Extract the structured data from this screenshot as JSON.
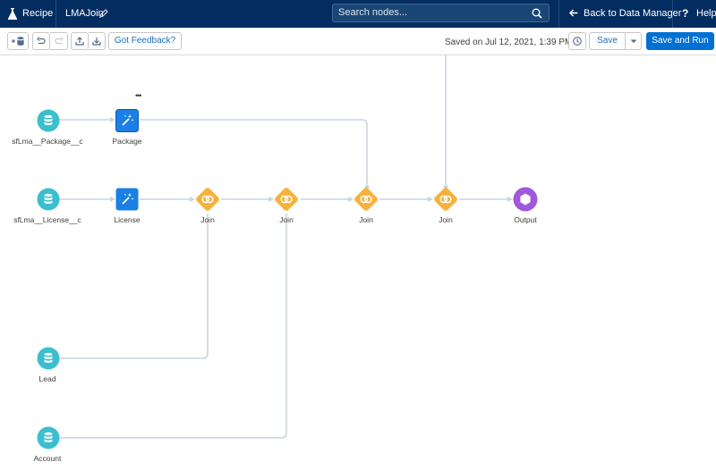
{
  "topbar": {
    "app_label": "Recipe",
    "recipe_name": "LMAJoin",
    "search_placeholder": "Search nodes...",
    "back_label": "Back to Data Manager",
    "help_label": "Help"
  },
  "toolbar": {
    "feedback_label": "Got Feedback?",
    "saved_text": "Saved on Jul 12, 2021, 1:39 PM",
    "save_label": "Save",
    "save_run_label": "Save and Run"
  },
  "nodes": {
    "package_source": {
      "label": "sfLma__Package__c",
      "type": "input"
    },
    "package_transform": {
      "label": "Package",
      "type": "transform"
    },
    "license_source": {
      "label": "sfLma__License__c",
      "type": "input"
    },
    "license_transform": {
      "label": "License",
      "type": "transform"
    },
    "join1": {
      "label": "Join",
      "type": "join"
    },
    "join2": {
      "label": "Join",
      "type": "join"
    },
    "join3": {
      "label": "Join",
      "type": "join"
    },
    "join4": {
      "label": "Join",
      "type": "join"
    },
    "output": {
      "label": "Output",
      "type": "output"
    },
    "lead_source": {
      "label": "Lead",
      "type": "input"
    },
    "account_source": {
      "label": "Account",
      "type": "input"
    }
  },
  "colors": {
    "topbar_bg": "#032d60",
    "input_node": "#3bbfcf",
    "transform_node": "#1b7fe5",
    "join_node": "#f7b23b",
    "output_node": "#a259d9",
    "edge": "#c9d3e0",
    "primary_button": "#0070d2"
  }
}
